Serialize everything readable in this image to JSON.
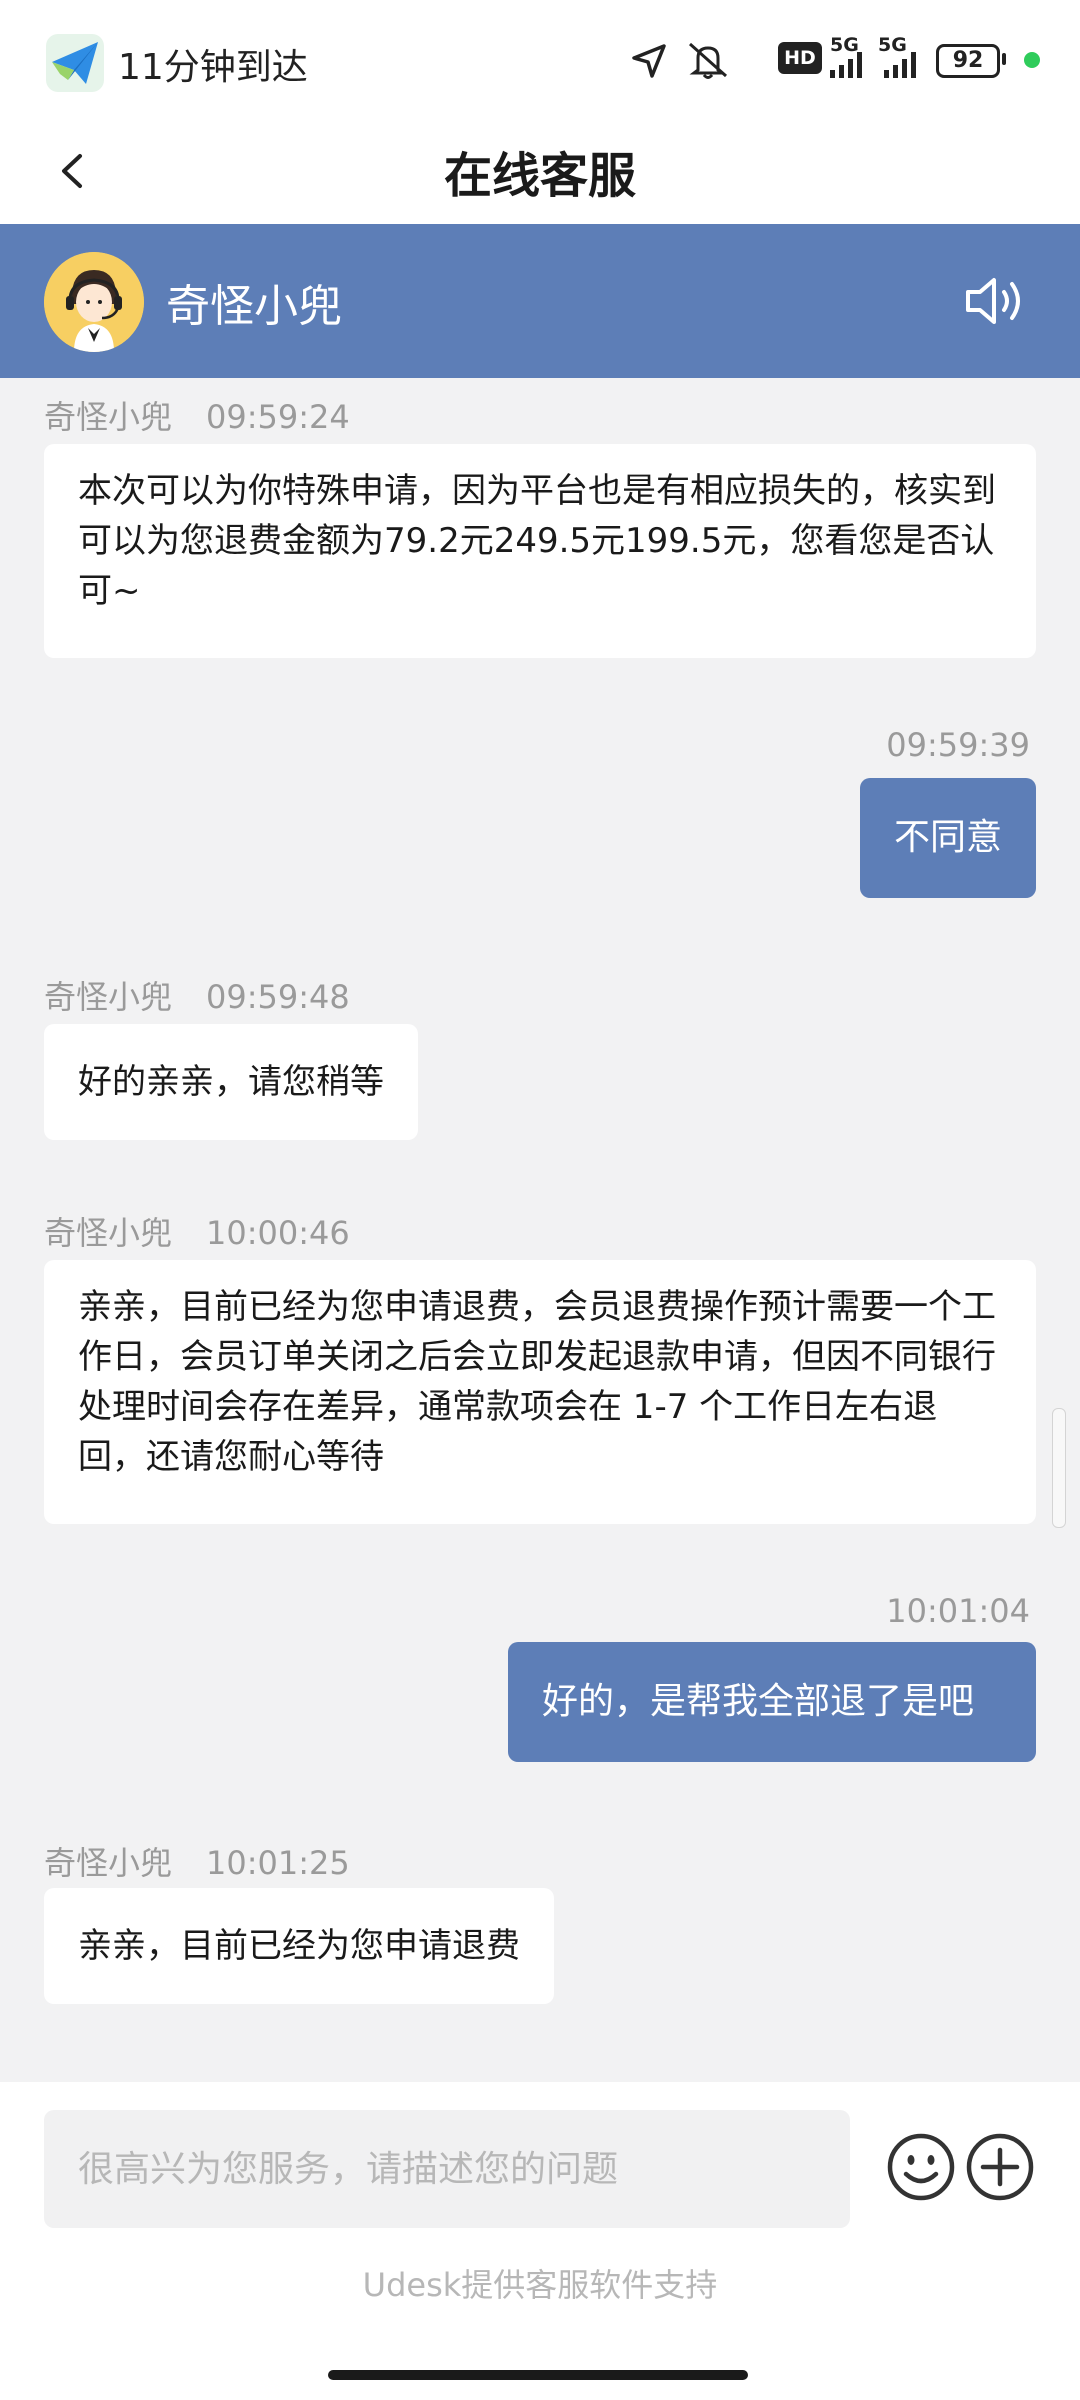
{
  "status_bar": {
    "app_text": "11分钟到达",
    "hd": "HD",
    "net1": "5G",
    "net2": "5G",
    "battery": "92",
    "icons": [
      "paper-plane-icon",
      "location-arrow-icon",
      "bell-off-icon",
      "signal-icon"
    ]
  },
  "nav": {
    "title": "在线客服",
    "back_icon": "chevron-left-icon"
  },
  "agent": {
    "name": "奇怪小兜",
    "speaker_icon": "speaker-icon"
  },
  "messages": [
    {
      "side": "agent",
      "sender": "奇怪小兜",
      "time": "09:59:24",
      "text": "本次可以为你特殊申请，因为平台也是有相应损失的，核实到可以为您退费金额为79.2元249.5元199.5元，您看您是否认可~"
    },
    {
      "side": "user",
      "time": "09:59:39",
      "text": "不同意"
    },
    {
      "side": "agent",
      "sender": "奇怪小兜",
      "time": "09:59:48",
      "text": "好的亲亲，请您稍等"
    },
    {
      "side": "agent",
      "sender": "奇怪小兜",
      "time": "10:00:46",
      "text": "亲亲，目前已经为您申请退费，会员退费操作预计需要一个工作日，会员订单关闭之后会立即发起退款申请，但因不同银行处理时间会存在差异，通常款项会在 1-7 个工作日左右退回，还请您耐心等待"
    },
    {
      "side": "user",
      "time": "10:01:04",
      "text": "好的，是帮我全部退了是吧"
    },
    {
      "side": "agent",
      "sender": "奇怪小兜",
      "time": "10:01:25",
      "text": "亲亲，目前已经为您申请退费"
    }
  ],
  "input": {
    "placeholder": "很高兴为您服务，请描述您的问题",
    "value": ""
  },
  "footer": {
    "powered_by": "Udesk提供客服软件支持",
    "emoji_icon": "smiley-icon",
    "plus_icon": "plus-circle-icon"
  },
  "colors": {
    "accent": "#5d7eb7",
    "background": "#f2f2f3",
    "bubble_agent": "#ffffff"
  }
}
